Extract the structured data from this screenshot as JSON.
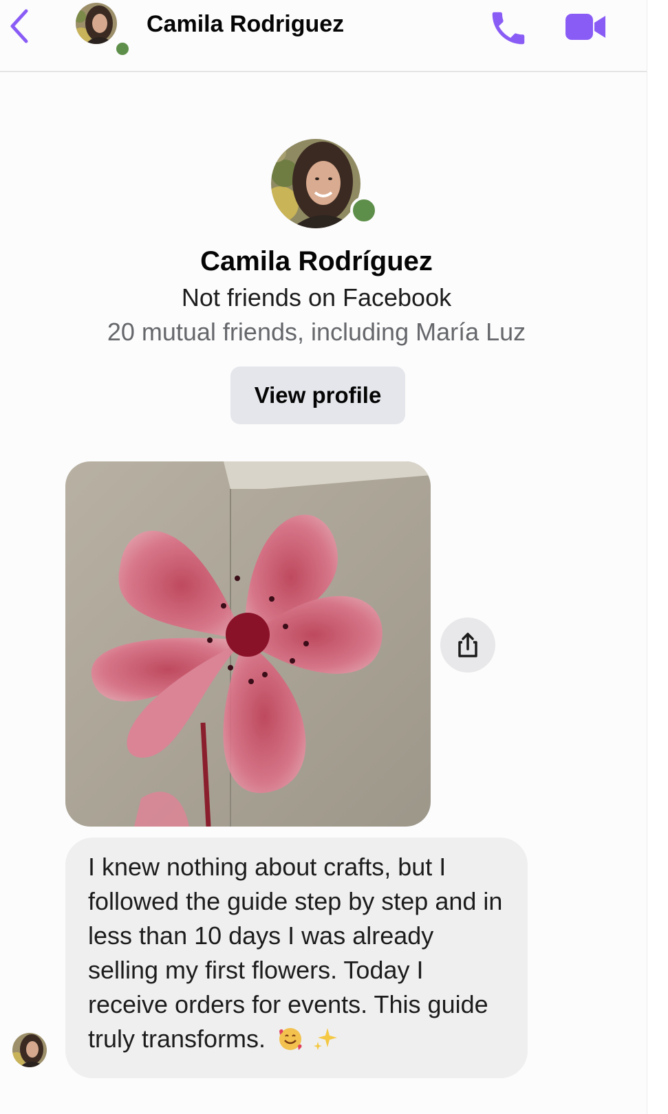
{
  "header": {
    "contact_name": "Camila Rodriguez",
    "online": true,
    "accent_color": "#8a5cf6",
    "online_color": "#5e8f4a",
    "icons": {
      "back": "chevron-left-icon",
      "call": "phone-icon",
      "video": "video-camera-icon"
    }
  },
  "profile": {
    "name": "Camila Rodríguez",
    "status": "Not friends on Facebook",
    "mutual": "20 mutual friends, including María Luz",
    "view_profile_label": "View profile"
  },
  "messages": [
    {
      "type": "image",
      "content": "photo of a pink fabric flower"
    },
    {
      "type": "text",
      "text": "I knew nothing about crafts, but I followed the guide step by step and in less than 10 days I was already selling my first flowers. Today I receive orders for events. This guide truly transforms.",
      "emojis": [
        "smiling-face-with-hearts",
        "sparkles"
      ]
    }
  ],
  "share_icon": "share-icon"
}
